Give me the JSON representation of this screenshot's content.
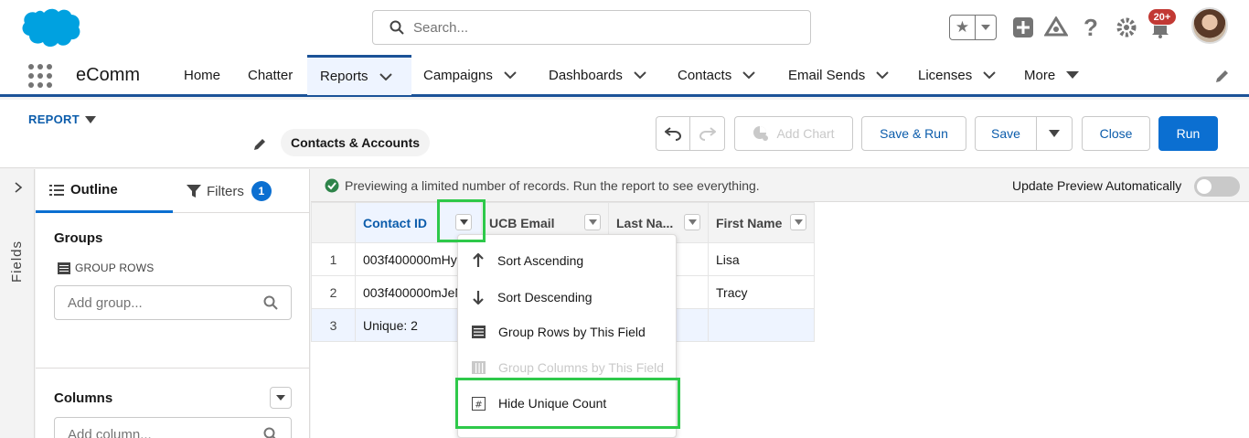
{
  "header": {
    "search_placeholder": "Search...",
    "notifications_badge": "20+"
  },
  "nav": {
    "app_name": "eComm",
    "items": [
      {
        "label": "Home"
      },
      {
        "label": "Chatter"
      },
      {
        "label": "Reports"
      },
      {
        "label": "Campaigns"
      },
      {
        "label": "Dashboards"
      },
      {
        "label": "Contacts"
      },
      {
        "label": "Email Sends"
      },
      {
        "label": "Licenses"
      },
      {
        "label": "More"
      }
    ]
  },
  "report": {
    "type_label": "REPORT",
    "name": "Contacts & Accounts",
    "buttons": {
      "add_chart": "Add Chart",
      "save_run": "Save & Run",
      "save": "Save",
      "close": "Close",
      "run": "Run"
    }
  },
  "left": {
    "fields_tab": "Fields",
    "outline_tab": "Outline",
    "filters_tab": "Filters",
    "filters_count": "1",
    "groups_title": "Groups",
    "group_rows_label": "GROUP ROWS",
    "add_group_placeholder": "Add group...",
    "columns_title": "Columns",
    "add_column_placeholder": "Add column..."
  },
  "preview": {
    "message": "Previewing a limited number of records. Run the report to see everything.",
    "auto_update_label": "Update Preview Automatically",
    "columns": [
      "Contact ID",
      "UCB Email",
      "Last Na...",
      "First Name"
    ],
    "rows": [
      {
        "num": "1",
        "contact_id": "003f400000mHy",
        "first_name": "Lisa"
      },
      {
        "num": "2",
        "contact_id": "003f400000mJeN",
        "first_name": "Tracy"
      },
      {
        "num": "3",
        "contact_id": "Unique: 2",
        "first_name": ""
      }
    ]
  },
  "dropdown": {
    "items": [
      {
        "label": "Sort Ascending",
        "icon": "arrow-up-icon"
      },
      {
        "label": "Sort Descending",
        "icon": "arrow-down-icon"
      },
      {
        "label": "Group Rows by This Field",
        "icon": "group-rows-icon"
      },
      {
        "label": "Group Columns by This Field",
        "icon": "group-columns-icon"
      },
      {
        "label": "Hide Unique Count",
        "icon": "hash-icon"
      }
    ]
  },
  "colors": {
    "brand": "#0b6fd1",
    "nav_accent": "#1b5297",
    "highlight": "#2ec94a",
    "badge": "#c23934"
  }
}
